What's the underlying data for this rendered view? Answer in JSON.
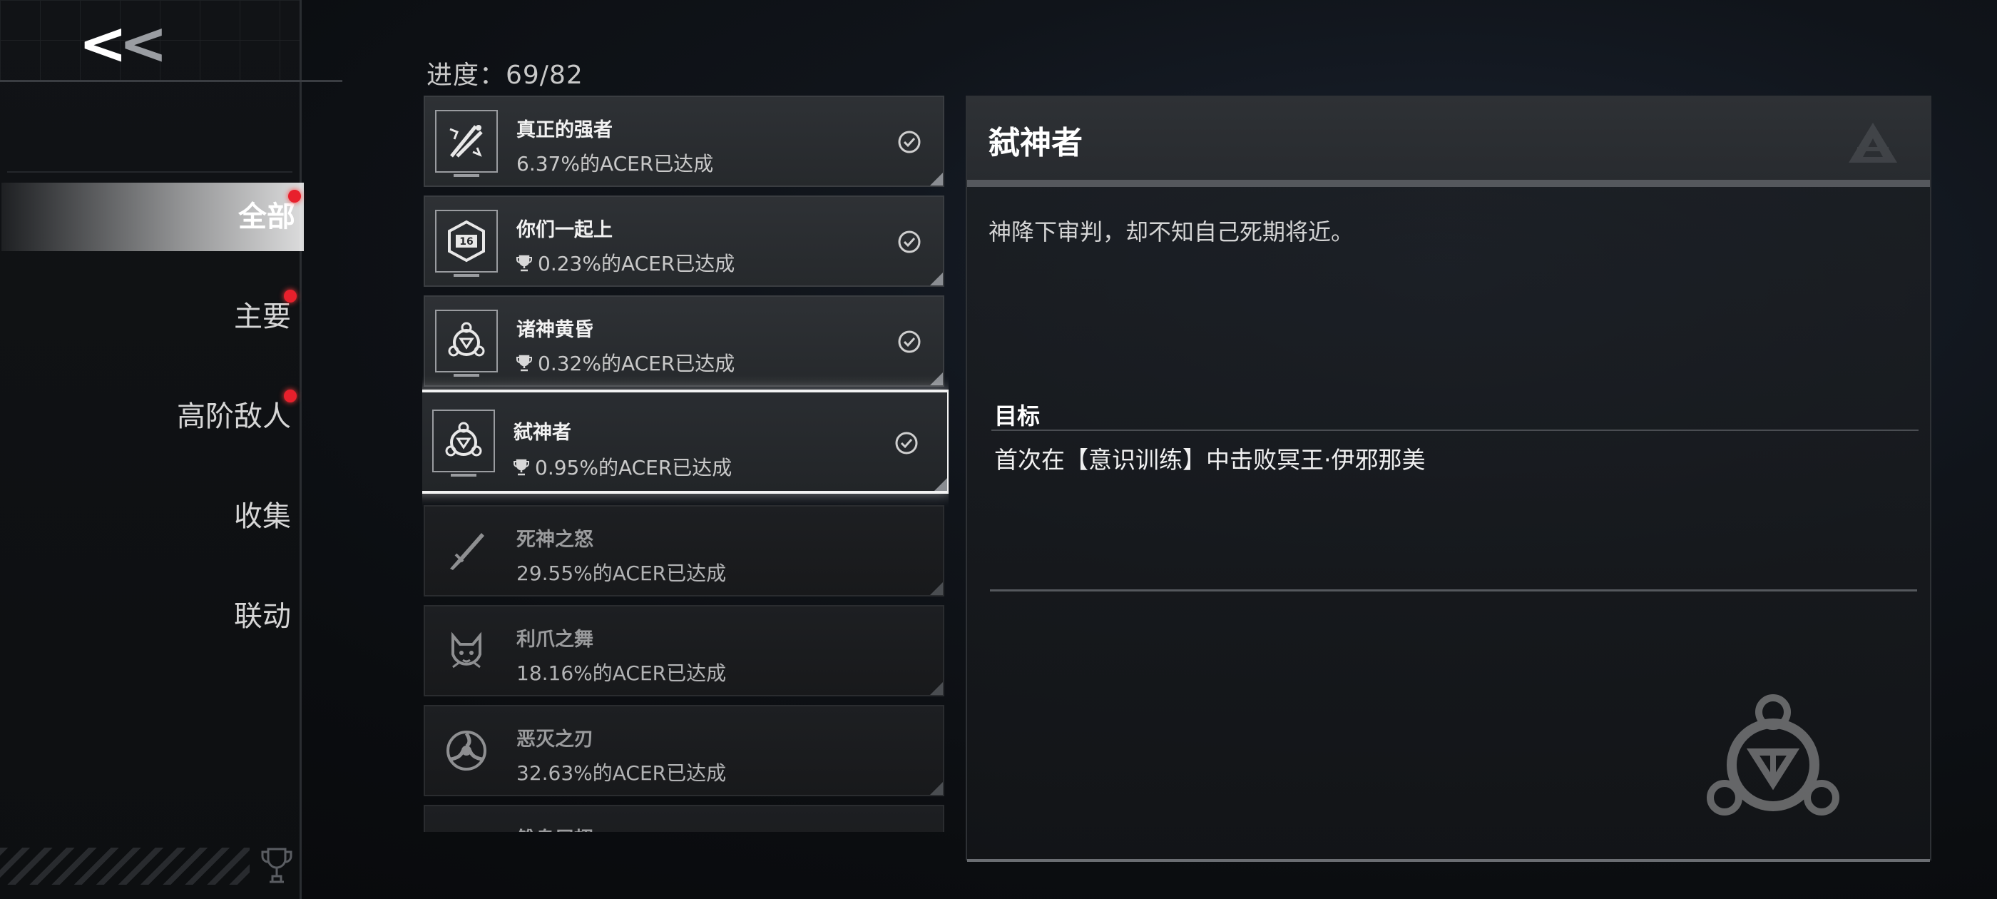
{
  "nav": {
    "back_label": "<<",
    "items": [
      {
        "label": "全部",
        "active": true,
        "badge": true
      },
      {
        "label": "主要",
        "active": false,
        "badge": true
      },
      {
        "label": "高阶敌人",
        "active": false,
        "badge": true
      },
      {
        "label": "收集",
        "active": false,
        "badge": false
      },
      {
        "label": "联动",
        "active": false,
        "badge": false
      }
    ]
  },
  "progress": {
    "text": "进度：69/82"
  },
  "achievements": [
    {
      "title": "真正的强者",
      "rate": "6.37%的ACER已达成",
      "trophy": false,
      "completed": true,
      "icon": "crossed-swords-icon"
    },
    {
      "title": "你们一起上",
      "rate": "0.23%的ACER已达成",
      "trophy": true,
      "completed": true,
      "icon": "hexagon-16-icon"
    },
    {
      "title": "诸神黄昏",
      "rate": "0.32%的ACER已达成",
      "trophy": true,
      "completed": true,
      "icon": "triskelion-icon"
    },
    {
      "title": "弑神者",
      "rate": "0.95%的ACER已达成",
      "trophy": true,
      "completed": true,
      "icon": "triskelion-icon",
      "selected": true
    },
    {
      "title": "死神之怒",
      "rate": "29.55%的ACER已达成",
      "trophy": false,
      "completed": false,
      "icon": "blade-icon"
    },
    {
      "title": "利爪之舞",
      "rate": "18.16%的ACER已达成",
      "trophy": false,
      "completed": false,
      "icon": "cat-face-icon"
    },
    {
      "title": "恶灭之刃",
      "rate": "32.63%的ACER已达成",
      "trophy": false,
      "completed": false,
      "icon": "triple-blade-circle-icon"
    },
    {
      "title": "雏鸟展翅",
      "rate": "",
      "trophy": false,
      "completed": false,
      "icon": "bird-icon"
    }
  ],
  "detail": {
    "name": "弑神者",
    "description": "神降下审判，却不知自己死期将近。",
    "goal_label": "目标",
    "goal_text": "首次在【意识训练】中击败冥王·伊邪那美"
  },
  "colors": {
    "badge": "#e8202c",
    "accent_white": "#f2f2f2",
    "background": "#0b0d10"
  }
}
